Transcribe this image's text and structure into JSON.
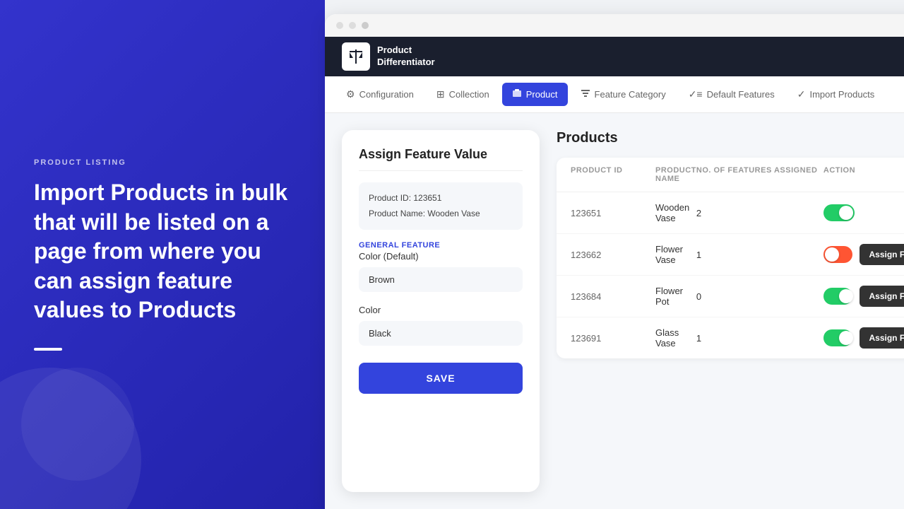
{
  "left": {
    "section_label": "PRODUCT LISTING",
    "hero_text": "Import Products in bulk that will be listed on a page from where you can assign feature values to Products"
  },
  "header": {
    "logo_icon": "⚖",
    "logo_text_line1": "Product",
    "logo_text_line2": "Differentiator"
  },
  "nav": {
    "tabs": [
      {
        "id": "configuration",
        "label": "Configuration",
        "icon": "⚙"
      },
      {
        "id": "collection",
        "label": "Collection",
        "icon": "⊞"
      },
      {
        "id": "product",
        "label": "Product",
        "icon": "🛍",
        "active": true
      },
      {
        "id": "feature-category",
        "label": "Feature Category",
        "icon": "≡"
      },
      {
        "id": "default-features",
        "label": "Default Features",
        "icon": "✓≡"
      },
      {
        "id": "import-products",
        "label": "Import Products",
        "icon": "✓"
      }
    ]
  },
  "assign_panel": {
    "title": "Assign Feature Value",
    "product_id_label": "Product ID: 123651",
    "product_name_label": "Product Name: Wooden Vase",
    "general_feature_label": "General Feature",
    "color_default_label": "Color (Default)",
    "color_default_value": "Brown",
    "color_label": "Color",
    "color_value": "Black",
    "save_button": "SAVE"
  },
  "products": {
    "title": "Products",
    "columns": [
      "Product ID",
      "Product Name",
      "No. of Features Assigned",
      "Action"
    ],
    "rows": [
      {
        "id": "123651",
        "name": "Wooden Vase",
        "features": "2",
        "toggle": "on",
        "show_assign": false
      },
      {
        "id": "123662",
        "name": "Flower Vase",
        "features": "1",
        "toggle": "off",
        "show_assign": true
      },
      {
        "id": "123684",
        "name": "Flower Pot",
        "features": "0",
        "toggle": "on",
        "show_assign": true
      },
      {
        "id": "123691",
        "name": "Glass Vase",
        "features": "1",
        "toggle": "on",
        "show_assign": true
      }
    ],
    "assign_btn_label": "Assign Feature Value"
  }
}
